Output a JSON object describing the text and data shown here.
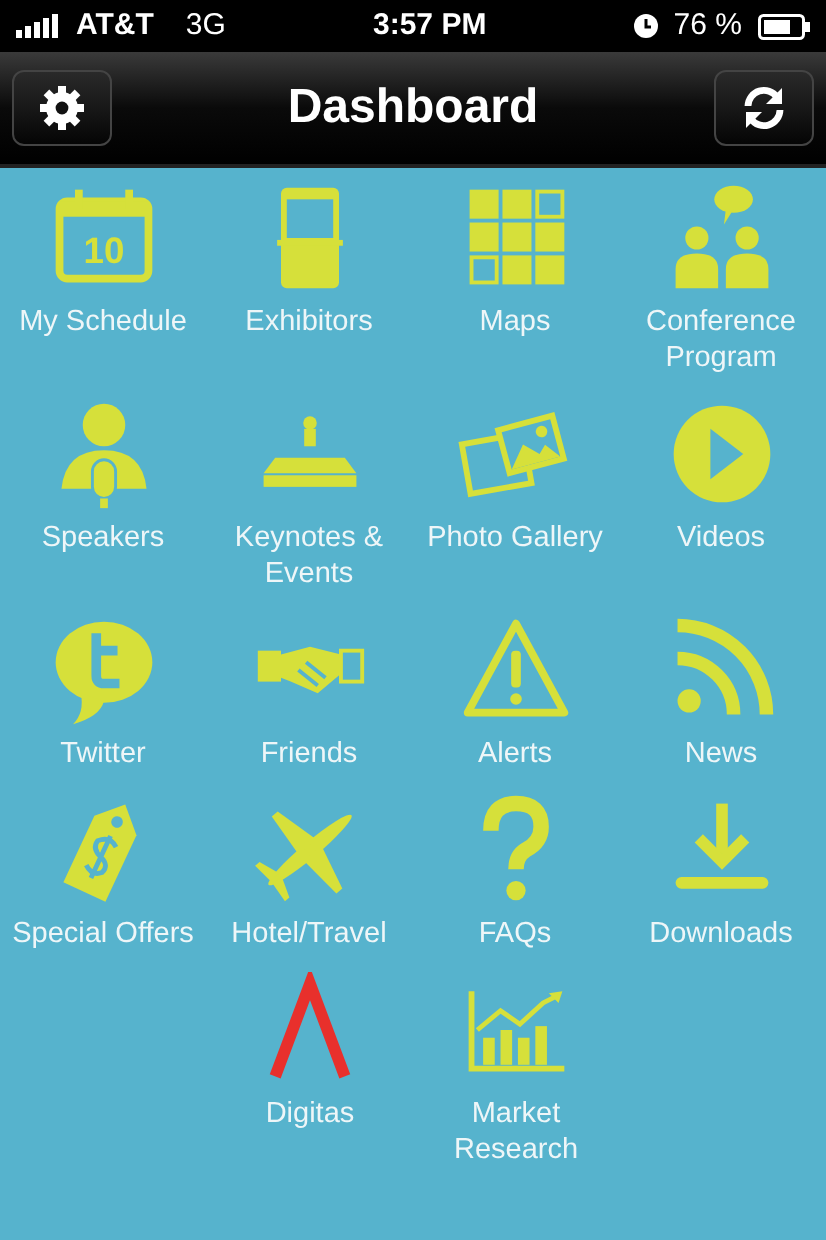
{
  "status_bar": {
    "carrier": "AT&T",
    "network": "3G",
    "time": "3:57 PM",
    "battery": "76 %"
  },
  "nav_bar": {
    "title": "Dashboard"
  },
  "tile_rows": [
    [
      {
        "label": "My Schedule",
        "icon_text": "10"
      },
      {
        "label": "Exhibitors"
      },
      {
        "label": "Maps"
      },
      {
        "label": "Conference Program"
      }
    ],
    [
      {
        "label": "Speakers"
      },
      {
        "label": "Keynotes & Events"
      },
      {
        "label": "Photo Gallery"
      },
      {
        "label": "Videos"
      }
    ],
    [
      {
        "label": "Twitter"
      },
      {
        "label": "Friends"
      },
      {
        "label": "Alerts"
      },
      {
        "label": "News"
      }
    ],
    [
      {
        "label": "Special Offers"
      },
      {
        "label": "Hotel/Travel"
      },
      {
        "label": "FAQs"
      },
      {
        "label": "Downloads"
      }
    ],
    [
      {
        "label": "Digitas"
      },
      {
        "label": "Market Research"
      }
    ]
  ]
}
